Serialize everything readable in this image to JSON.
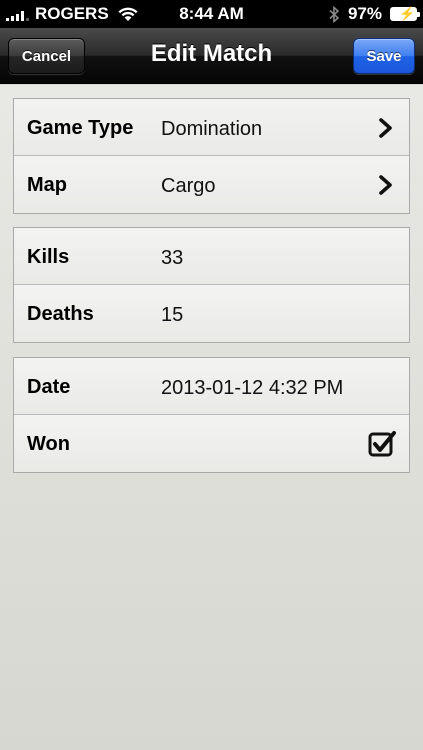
{
  "status_bar": {
    "carrier": "ROGERS",
    "time": "8:44 AM",
    "battery": "97%"
  },
  "nav": {
    "title": "Edit Match",
    "cancel_label": "Cancel",
    "save_label": "Save"
  },
  "groups": [
    {
      "rows": [
        {
          "label": "Game Type",
          "value": "Domination",
          "accessory": "chevron-right-icon"
        },
        {
          "label": "Map",
          "value": "Cargo",
          "accessory": "chevron-right-icon"
        }
      ]
    },
    {
      "rows": [
        {
          "label": "Kills",
          "value": "33"
        },
        {
          "label": "Deaths",
          "value": "15"
        }
      ]
    },
    {
      "rows": [
        {
          "label": "Date",
          "value": "2013-01-12 4:32 PM"
        },
        {
          "label": "Won",
          "value": "",
          "checked": true,
          "accessory": "checkbox-checked-icon"
        }
      ]
    }
  ],
  "colors": {
    "save_button": "#2a6ce8",
    "nav_bar": "#1a1a1a",
    "background": "#d7d7d2"
  }
}
